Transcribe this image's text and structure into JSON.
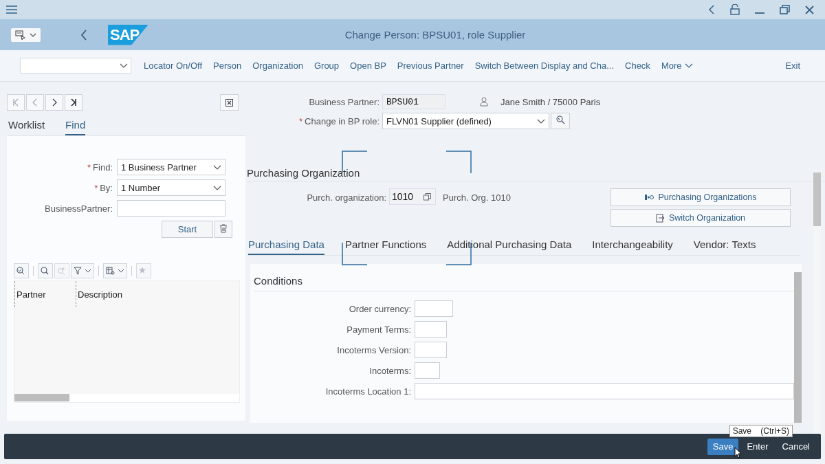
{
  "header": {
    "logo": "SAP",
    "title": "Change Person: BPSU01, role Supplier"
  },
  "toolbar": {
    "items": [
      "Locator On/Off",
      "Person",
      "Organization",
      "Group",
      "Open BP",
      "Previous Partner",
      "Switch Between Display and Cha...",
      "Check"
    ],
    "more": "More",
    "exit": "Exit"
  },
  "side_panel": {
    "tabs": [
      {
        "label": "Worklist",
        "selected": false
      },
      {
        "label": "Find",
        "selected": true
      }
    ],
    "fields": [
      {
        "marker": "*",
        "label": "Find:",
        "value": "1 Business Partner",
        "kind": "dropdown"
      },
      {
        "marker": "*",
        "label": "By:",
        "value": "1 Number",
        "kind": "dropdown"
      },
      {
        "label": "BusinessPartner:",
        "kind": "text"
      }
    ],
    "start_button": "Start",
    "table": {
      "columns": [
        "Partner",
        "Description"
      ]
    }
  },
  "partner": {
    "bp_label": "Business Partner:",
    "bp_value": "BPSU01",
    "name": "Jane Smith / 75000 Paris",
    "role_marker": "*",
    "role_label": "Change in BP role:",
    "role_value": "FLVN01 Supplier (defined)"
  },
  "purchasing_org": {
    "title": "Purchasing Organization",
    "label": "Purch. organization:",
    "value": "1010",
    "description": "Purch. Org. 1010",
    "buttons": [
      "Purchasing Organizations",
      "Switch Organization"
    ]
  },
  "tabs": [
    {
      "label": "Purchasing Data",
      "selected": true
    },
    {
      "label": "Partner Functions",
      "selected": false
    },
    {
      "label": "Additional Purchasing Data",
      "selected": false
    },
    {
      "label": "Interchangeability",
      "selected": false
    },
    {
      "label": "Vendor: Texts",
      "selected": false
    }
  ],
  "conditions": {
    "title": "Conditions",
    "fields": [
      {
        "label": "Order currency:"
      },
      {
        "label": "Payment Terms:"
      },
      {
        "label": "Incoterms Version:"
      },
      {
        "label": "Incoterms:"
      },
      {
        "label": "Incoterms Location 1:"
      }
    ]
  },
  "footer": {
    "buttons": [
      {
        "label": "Save",
        "primary": true
      },
      {
        "label": "Enter",
        "primary": false
      },
      {
        "label": "Cancel",
        "primary": false
      }
    ],
    "tooltip": "Save    (Ctrl+S)"
  }
}
